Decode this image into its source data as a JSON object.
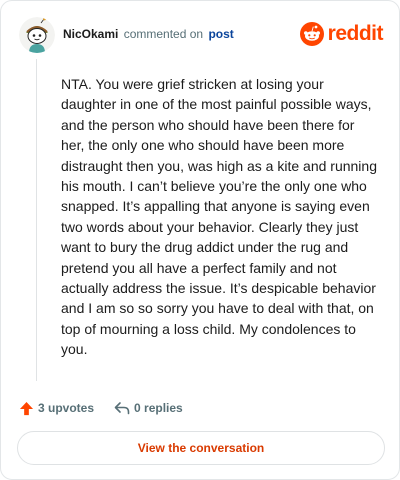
{
  "comment": {
    "username": "NicOkami",
    "action_text": "commented on",
    "target_label": "post",
    "avatar_icon": "snoo-avatar-icon",
    "body": "NTA. You were grief stricken at losing your daughter in one of the most painful possible ways, and the person who should have been there for her, the only one who should have been more distraught then you, was high as a kite and running his mouth. I can’t believe you’re the only one who snapped. It’s appalling that anyone is saying even two words about your behavior. Clearly they just want to bury the drug addict under the rug and pretend you all have a perfect family and not actually address the issue. It’s despicable behavior and I am so so sorry you have to deal with that, on top of mourning a loss child. My condolences to you."
  },
  "brand": {
    "wordmark": "reddit",
    "icon": "reddit-logo-icon",
    "color": "#ff4500"
  },
  "actions": {
    "upvotes_label": "3 upvotes",
    "upvote_icon": "upvote-arrow-icon",
    "upvote_color": "#ff4500",
    "replies_label": "0 replies",
    "reply_icon": "reply-arrow-icon"
  },
  "footer": {
    "view_button_label": "View the conversation",
    "button_text_color": "#d93a00"
  }
}
